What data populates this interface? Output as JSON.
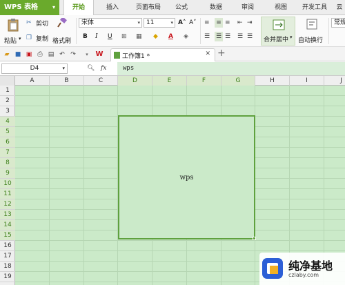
{
  "app": {
    "name": "WPS 表格"
  },
  "menu": {
    "tabs": [
      {
        "label": "开始",
        "active": true
      },
      {
        "label": "插入"
      },
      {
        "label": "页面布局"
      },
      {
        "label": "公式"
      },
      {
        "label": "数据"
      },
      {
        "label": "审阅"
      },
      {
        "label": "视图"
      },
      {
        "label": "开发工具"
      },
      {
        "label": "云"
      }
    ]
  },
  "ribbon": {
    "paste": "粘贴",
    "cut": "剪切",
    "copy": "复制",
    "format_painter": "格式刷",
    "font_name": "宋体",
    "font_size": "11",
    "bold": "B",
    "italic": "I",
    "underline": "U",
    "merge_center": "合并居中",
    "wrap_text": "自动换行",
    "style_partial": "常规"
  },
  "tabs_bar": {
    "doc_title": "工作簿1 *"
  },
  "formula_bar": {
    "name_box": "D4",
    "fx": "fx",
    "formula": "wps"
  },
  "sheet": {
    "columns": [
      "A",
      "B",
      "C",
      "D",
      "E",
      "F",
      "G",
      "H",
      "I",
      "J"
    ],
    "rows": [
      "1",
      "2",
      "3",
      "4",
      "5",
      "6",
      "7",
      "8",
      "9",
      "10",
      "11",
      "12",
      "13",
      "14",
      "15",
      "16",
      "17",
      "18",
      "19"
    ],
    "merged_range": "D4:G15",
    "merged_value": "wps",
    "grid_color": "#cbeac9",
    "selection_color": "#5fa13e"
  },
  "watermark": {
    "title": "纯净基地",
    "url": "czlaby.com"
  }
}
